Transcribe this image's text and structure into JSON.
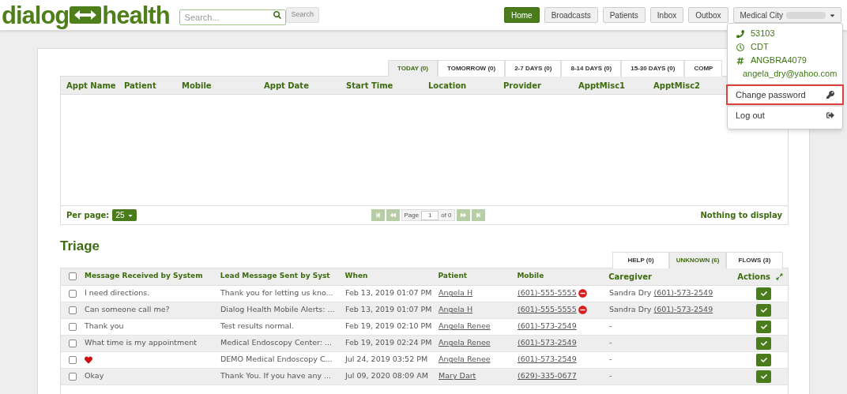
{
  "header": {
    "logo_left": "dialog",
    "logo_right": "health",
    "search": {
      "placeholder": "Search..."
    },
    "search_button": "Search",
    "nav": [
      {
        "label": "Home",
        "selected": true
      },
      {
        "label": "Broadcasts",
        "selected": false
      },
      {
        "label": "Patients",
        "selected": false
      },
      {
        "label": "Inbox",
        "selected": false
      },
      {
        "label": "Outbox",
        "selected": false
      }
    ],
    "account": {
      "label": "Medical City"
    }
  },
  "account_menu": {
    "info": [
      {
        "kind": "phone",
        "text": "53103"
      },
      {
        "kind": "clock",
        "text": "CDT"
      },
      {
        "kind": "hash",
        "text": "ANGBRA4079"
      },
      {
        "kind": "user",
        "text": "angela_dry@yahoo.com"
      }
    ],
    "actions": [
      {
        "kind": "key",
        "label": "Change password",
        "highlighted": true
      },
      {
        "kind": "logout",
        "label": "Log out",
        "highlighted": false
      }
    ]
  },
  "appointments": {
    "tabs": [
      {
        "label": "TODAY (0)",
        "selected": true
      },
      {
        "label": "TOMORROW (0)",
        "selected": false
      },
      {
        "label": "2-7 DAYS (0)",
        "selected": false
      },
      {
        "label": "8-14 DAYS (0)",
        "selected": false
      },
      {
        "label": "15-30 DAYS (0)",
        "selected": false
      },
      {
        "label": "COMP",
        "selected": false
      }
    ],
    "columns": [
      "Appt Name",
      "Patient",
      "Mobile",
      "Appt Date",
      "Start Time",
      "Location",
      "Provider",
      "ApptMisc1",
      "ApptMisc2"
    ],
    "per_page_label": "Per page:",
    "per_page": "25",
    "page_label": "Page",
    "page": "1",
    "page_of": "of 0",
    "status": "Nothing to display"
  },
  "triage": {
    "title": "Triage",
    "select_all": false,
    "tabs": [
      {
        "label": "HELP (0)",
        "selected": false
      },
      {
        "label": "UNKNOWN (6)",
        "selected": true
      },
      {
        "label": "FLOWS (3)",
        "selected": false
      }
    ],
    "columns": [
      "Message Received by System",
      "Lead Message Sent by Syst",
      "When",
      "Patient",
      "Mobile",
      "Caregiver",
      "Actions"
    ],
    "rows": [
      {
        "checked": false,
        "message": {
          "kind": "text",
          "text": "I need directions."
        },
        "lead": "Thank you for letting us kno...",
        "when": "Feb 13, 2019 01:07 PM",
        "patient": "Angela H",
        "mobile": "(601)-555-5555",
        "blocked": true,
        "caregiver_name": "Sandra Dry",
        "caregiver_phone": "(601)-573-2549"
      },
      {
        "checked": false,
        "message": {
          "kind": "text",
          "text": "Can someone call me?"
        },
        "lead": "Dialog Health Mobile Alerts: ...",
        "when": "Feb 13, 2019 01:07 PM",
        "patient": "Angela H",
        "mobile": "(601)-555-5555",
        "blocked": true,
        "caregiver_name": "Sandra Dry",
        "caregiver_phone": "(601)-573-2549"
      },
      {
        "checked": false,
        "message": {
          "kind": "text",
          "text": "Thank you"
        },
        "lead": "Test results normal.",
        "when": "Feb 19, 2019 02:10 PM",
        "patient": "Angela Renee",
        "mobile": "(601)-573-2549",
        "blocked": false,
        "caregiver_name": "-"
      },
      {
        "checked": false,
        "message": {
          "kind": "text",
          "text": "What time is my appointment"
        },
        "lead": "Medical Endoscopy Center: ...",
        "when": "Feb 19, 2019 02:24 PM",
        "patient": "Angela Renee",
        "mobile": "(601)-573-2549",
        "blocked": false,
        "caregiver_name": "-"
      },
      {
        "checked": false,
        "message": {
          "kind": "heart"
        },
        "lead": "DEMO Medical Endoscopy C...",
        "when": "Jul 24, 2019 03:52 PM",
        "patient": "Angela Renee",
        "mobile": "(601)-573-2549",
        "blocked": false,
        "caregiver_name": "-"
      },
      {
        "checked": false,
        "message": {
          "kind": "text",
          "text": "Okay"
        },
        "lead": "Thank You. If you have any ...",
        "when": "Jul 09, 2020 08:09 AM",
        "patient": "Mary Dart",
        "mobile": "(629)-335-0677",
        "blocked": false,
        "caregiver_name": "-"
      }
    ]
  }
}
